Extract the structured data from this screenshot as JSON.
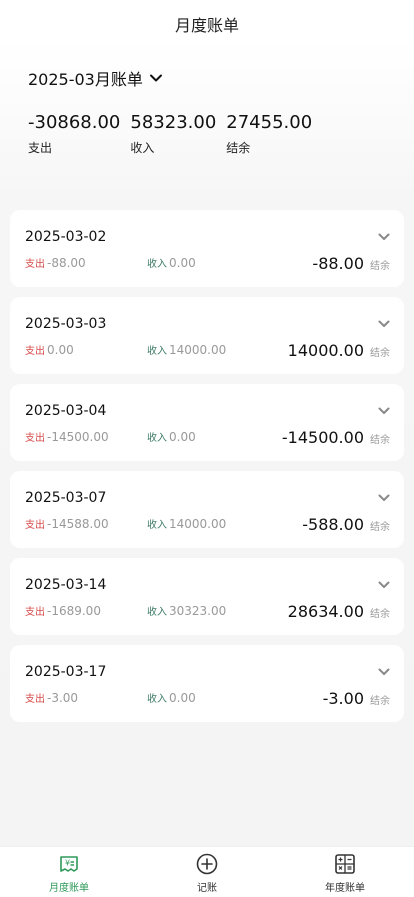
{
  "header": {
    "title": "月度账单"
  },
  "month": {
    "label": "2025-03月账单",
    "icon": "chevron-down-icon"
  },
  "summary": [
    {
      "value": "-30868.00",
      "label": "支出"
    },
    {
      "value": "58323.00",
      "label": "收入"
    },
    {
      "value": "27455.00",
      "label": "结余"
    }
  ],
  "labels": {
    "expense": "支出",
    "income": "收入",
    "balance": "结余"
  },
  "colors": {
    "expense": "#d74a4a",
    "income": "#3c7a66",
    "active_tab": "#2f9a5a"
  },
  "days": [
    {
      "date": "2025-03-02",
      "expense": "-88.00",
      "income": "0.00",
      "balance": "-88.00"
    },
    {
      "date": "2025-03-03",
      "expense": "0.00",
      "income": "14000.00",
      "balance": "14000.00"
    },
    {
      "date": "2025-03-04",
      "expense": "-14500.00",
      "income": "0.00",
      "balance": "-14500.00"
    },
    {
      "date": "2025-03-07",
      "expense": "-14588.00",
      "income": "14000.00",
      "balance": "-588.00"
    },
    {
      "date": "2025-03-14",
      "expense": "-1689.00",
      "income": "30323.00",
      "balance": "28634.00"
    },
    {
      "date": "2025-03-17",
      "expense": "-3.00",
      "income": "0.00",
      "balance": "-3.00"
    }
  ],
  "tabs": [
    {
      "label": "月度账单",
      "icon": "monthly-bill-icon",
      "active": true
    },
    {
      "label": "记账",
      "icon": "add-circle-icon",
      "active": false
    },
    {
      "label": "年度账单",
      "icon": "calculator-icon",
      "active": false
    }
  ]
}
